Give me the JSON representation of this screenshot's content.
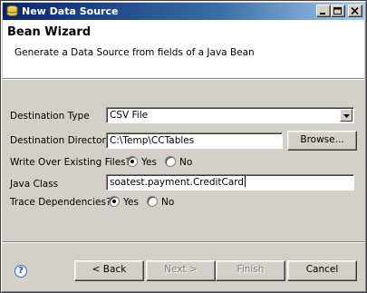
{
  "window": {
    "title": "New Data Source",
    "icon": "data-source-icon"
  },
  "banner": {
    "heading": "Bean Wizard",
    "description": "Generate a Data Source from fields of a Java Bean"
  },
  "form": {
    "destination_type_label": "Destination Type",
    "destination_type_value": "CSV File",
    "destination_directory_label": "Destination Directory",
    "destination_directory_value": "C:\\Temp\\CCTables",
    "browse_label": "Browse...",
    "overwrite_label": "Write Over Existing Files?",
    "overwrite_yes": "Yes",
    "overwrite_no": "No",
    "overwrite_selected": "Yes",
    "java_class_label": "Java Class",
    "java_class_value": "soatest.payment.CreditCard",
    "trace_label": "Trace Dependencies?",
    "trace_yes": "Yes",
    "trace_no": "No",
    "trace_selected": "Yes"
  },
  "footer": {
    "help_icon": "question-mark-icon",
    "back_label": "< Back",
    "next_label": "Next >",
    "finish_label": "Finish",
    "cancel_label": "Cancel"
  }
}
